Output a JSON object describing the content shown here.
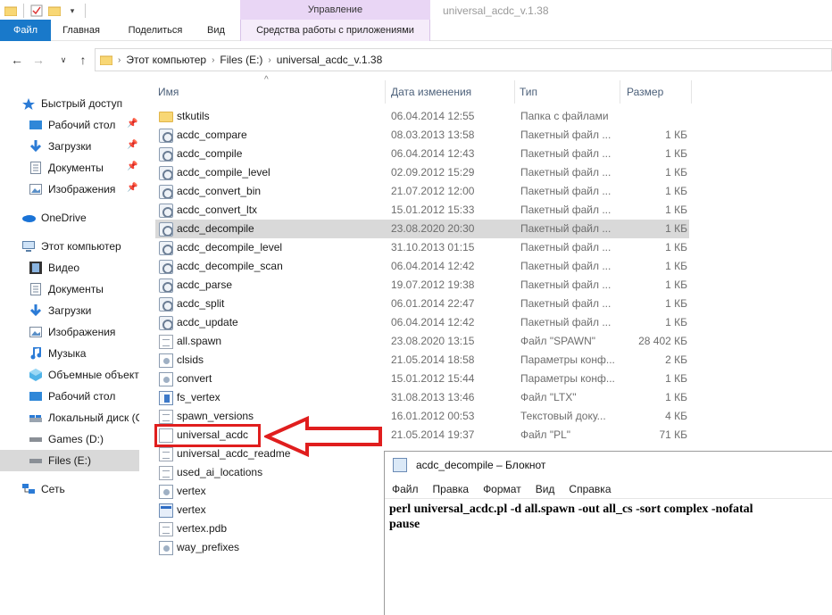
{
  "ribbon": {
    "context_group": "Управление",
    "window_title": "universal_acdc_v.1.38",
    "tabs": {
      "file": "Файл",
      "home": "Главная",
      "share": "Поделиться",
      "view": "Вид",
      "app_tools": "Средства работы с приложениями"
    }
  },
  "address": {
    "crumbs": [
      "Этот компьютер",
      "Files (E:)",
      "universal_acdc_v.1.38"
    ]
  },
  "nav": {
    "items": [
      {
        "label": "Быстрый доступ",
        "icon": "star-icon"
      },
      {
        "label": "Рабочий стол",
        "icon": "desktop-icon"
      },
      {
        "label": "Загрузки",
        "icon": "download-icon"
      },
      {
        "label": "Документы",
        "icon": "documents-icon"
      },
      {
        "label": "Изображения",
        "icon": "pictures-icon"
      },
      {
        "label": "OneDrive",
        "icon": "cloud-icon"
      },
      {
        "label": "Этот компьютер",
        "icon": "computer-icon"
      },
      {
        "label": "Видео",
        "icon": "video-icon"
      },
      {
        "label": "Документы",
        "icon": "documents-icon"
      },
      {
        "label": "Загрузки",
        "icon": "download-icon"
      },
      {
        "label": "Изображения",
        "icon": "pictures-icon"
      },
      {
        "label": "Музыка",
        "icon": "music-icon"
      },
      {
        "label": "Объемные объекты",
        "icon": "3d-objects-icon"
      },
      {
        "label": "Рабочий стол",
        "icon": "desktop-icon"
      },
      {
        "label": "Локальный диск (C:)",
        "icon": "drive-icon"
      },
      {
        "label": "Games (D:)",
        "icon": "drive-icon"
      },
      {
        "label": "Files (E:)",
        "icon": "drive-icon"
      },
      {
        "label": "Сеть",
        "icon": "network-icon"
      }
    ]
  },
  "columns": {
    "name": "Имя",
    "date": "Дата изменения",
    "type": "Тип",
    "size": "Размер"
  },
  "files": [
    {
      "name": "stkutils",
      "date": "06.04.2014 12:55",
      "type": "Папка с файлами",
      "size": "",
      "icon": "folder-icon"
    },
    {
      "name": "acdc_compare",
      "date": "08.03.2013 13:58",
      "type": "Пакетный файл ...",
      "size": "1 КБ",
      "icon": "batch-file-icon"
    },
    {
      "name": "acdc_compile",
      "date": "06.04.2014 12:43",
      "type": "Пакетный файл ...",
      "size": "1 КБ",
      "icon": "batch-file-icon"
    },
    {
      "name": "acdc_compile_level",
      "date": "02.09.2012 15:29",
      "type": "Пакетный файл ...",
      "size": "1 КБ",
      "icon": "batch-file-icon"
    },
    {
      "name": "acdc_convert_bin",
      "date": "21.07.2012 12:00",
      "type": "Пакетный файл ...",
      "size": "1 КБ",
      "icon": "batch-file-icon"
    },
    {
      "name": "acdc_convert_ltx",
      "date": "15.01.2012 15:33",
      "type": "Пакетный файл ...",
      "size": "1 КБ",
      "icon": "batch-file-icon"
    },
    {
      "name": "acdc_decompile",
      "date": "23.08.2020 20:30",
      "type": "Пакетный файл ...",
      "size": "1 КБ",
      "icon": "batch-file-icon"
    },
    {
      "name": "acdc_decompile_level",
      "date": "31.10.2013 01:15",
      "type": "Пакетный файл ...",
      "size": "1 КБ",
      "icon": "batch-file-icon"
    },
    {
      "name": "acdc_decompile_scan",
      "date": "06.04.2014 12:42",
      "type": "Пакетный файл ...",
      "size": "1 КБ",
      "icon": "batch-file-icon"
    },
    {
      "name": "acdc_parse",
      "date": "19.07.2012 19:38",
      "type": "Пакетный файл ...",
      "size": "1 КБ",
      "icon": "batch-file-icon"
    },
    {
      "name": "acdc_split",
      "date": "06.01.2014 22:47",
      "type": "Пакетный файл ...",
      "size": "1 КБ",
      "icon": "batch-file-icon"
    },
    {
      "name": "acdc_update",
      "date": "06.04.2014 12:42",
      "type": "Пакетный файл ...",
      "size": "1 КБ",
      "icon": "batch-file-icon"
    },
    {
      "name": "all.spawn",
      "date": "23.08.2020 13:15",
      "type": "Файл \"SPAWN\"",
      "size": "28 402 КБ",
      "icon": "file-icon"
    },
    {
      "name": "clsids",
      "date": "21.05.2014 18:58",
      "type": "Параметры конф...",
      "size": "2 КБ",
      "icon": "settings-file-icon"
    },
    {
      "name": "convert",
      "date": "15.01.2012 15:44",
      "type": "Параметры конф...",
      "size": "1 КБ",
      "icon": "settings-file-icon"
    },
    {
      "name": "fs_vertex",
      "date": "31.08.2013 13:46",
      "type": "Файл \"LTX\"",
      "size": "1 КБ",
      "icon": "ltx-file-icon"
    },
    {
      "name": "spawn_versions",
      "date": "16.01.2012 00:53",
      "type": "Текстовый доку...",
      "size": "4 КБ",
      "icon": "text-file-icon"
    },
    {
      "name": "universal_acdc",
      "date": "21.05.2014 19:37",
      "type": "Файл \"PL\"",
      "size": "71 КБ",
      "icon": "pl-file-icon"
    },
    {
      "name": "universal_acdc_readme",
      "date": "",
      "type": "",
      "size": "",
      "icon": "text-file-icon"
    },
    {
      "name": "used_ai_locations",
      "date": "",
      "type": "",
      "size": "",
      "icon": "text-file-icon"
    },
    {
      "name": "vertex",
      "date": "",
      "type": "",
      "size": "",
      "icon": "settings-file-icon"
    },
    {
      "name": "vertex",
      "date": "",
      "type": "",
      "size": "",
      "icon": "exe-file-icon"
    },
    {
      "name": "vertex.pdb",
      "date": "",
      "type": "",
      "size": "",
      "icon": "file-icon"
    },
    {
      "name": "way_prefixes",
      "date": "",
      "type": "",
      "size": "",
      "icon": "settings-file-icon"
    }
  ],
  "selected_file": "acdc_decompile",
  "highlighted_file": "universal_acdc",
  "notepad": {
    "title": "acdc_decompile – Блокнот",
    "menu": [
      "Файл",
      "Правка",
      "Формат",
      "Вид",
      "Справка"
    ],
    "lines": [
      "perl universal_acdc.pl -d all.spawn -out all_cs -sort complex -nofatal",
      "pause"
    ]
  },
  "colors": {
    "file_tab": "#1979ca",
    "context_band": "#e9d6f5",
    "selection": "#d9d9d9",
    "annotation": "#e01e1e",
    "header_text": "#4c607a"
  }
}
